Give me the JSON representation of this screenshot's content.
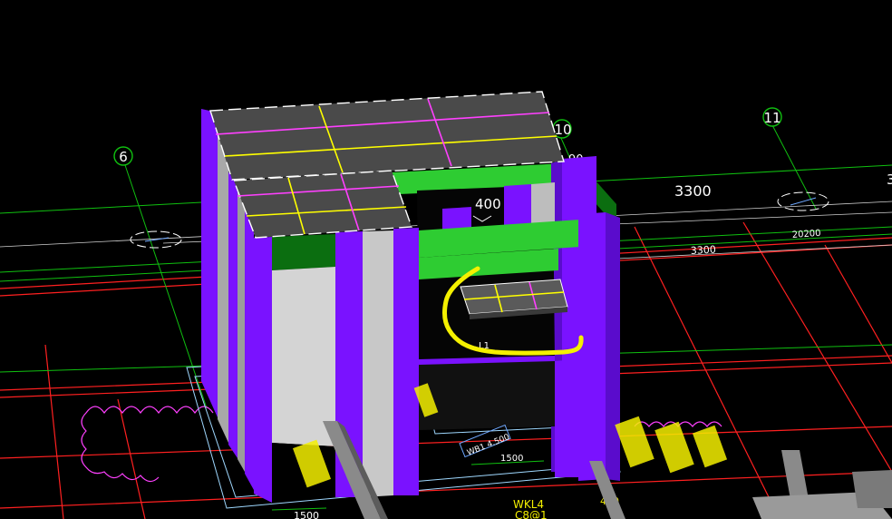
{
  "viewport": {
    "background": "#000000"
  },
  "axes": {
    "axis_6": "6",
    "axis_10": "10",
    "axis_11": "11",
    "axis_next": "3"
  },
  "dimensions": {
    "dim_400": "400",
    "dim_3300_top": "3300",
    "dim_3300_small": "3300",
    "dim_20200": "20200",
    "dim_1500_center": "1500",
    "dim_1500_bottom": "1500",
    "dim_400_bottom": "400",
    "dim_90": "90"
  },
  "labels": {
    "beam_wkl": "WKL4",
    "beam_c8": "C8@1",
    "slab_tag": "WB1 4.500",
    "l1": "L1"
  },
  "colors": {
    "column_purple": "#7a12ff",
    "beam_green": "#2ecc32",
    "beam_dark_green": "#0b6e10",
    "slab_gray": "#4a4a4a",
    "wall_gray": "#c8c8c8",
    "grid_red": "#ff2020",
    "grid_green": "#10c010",
    "rebar_yellow": "#ffff00",
    "rebar_magenta": "#ff40ff",
    "annotation_yellow": "#f4f000"
  }
}
